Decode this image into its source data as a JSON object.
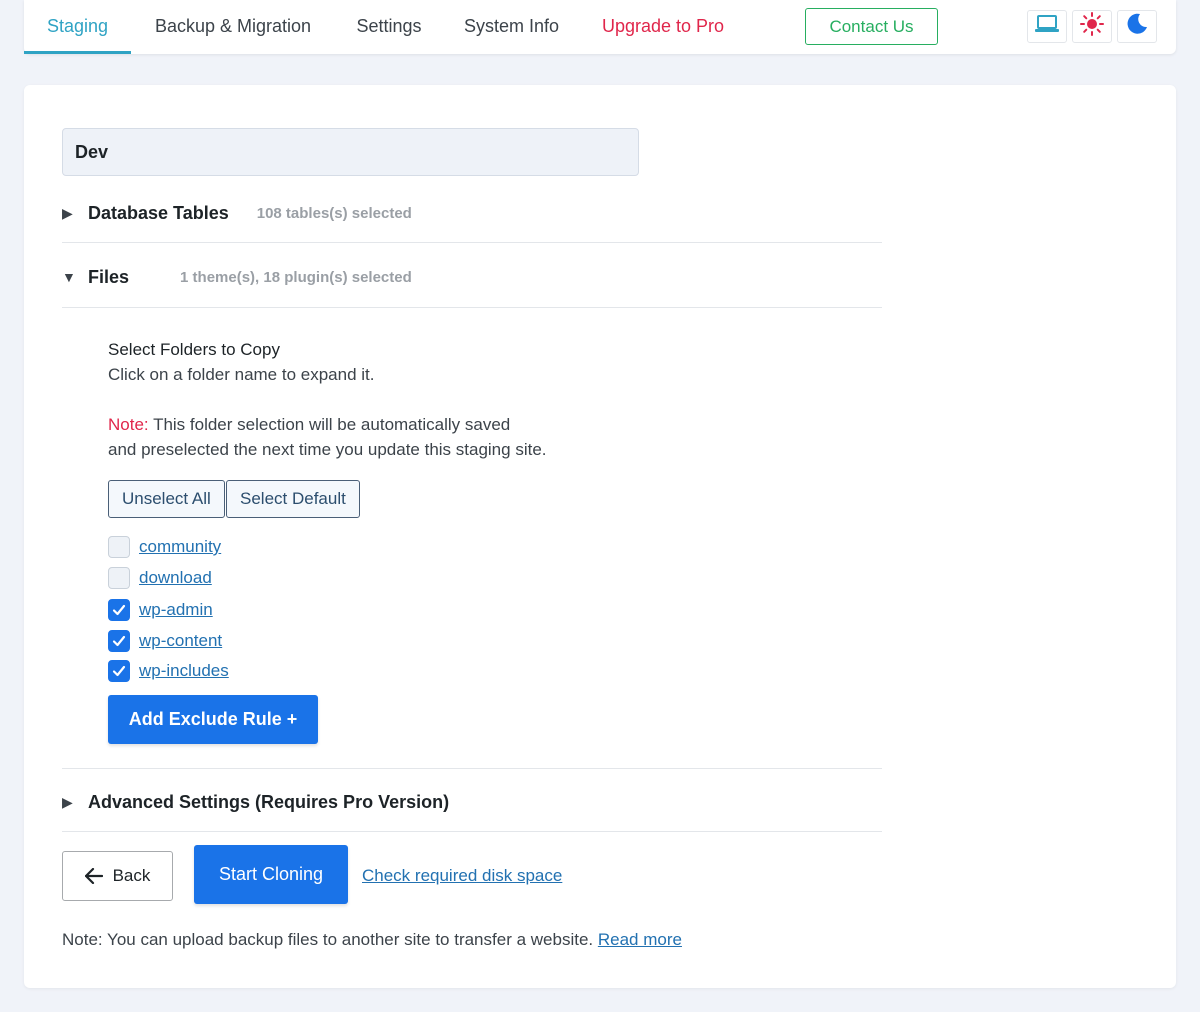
{
  "nav": {
    "tabs": [
      {
        "label": "Staging"
      },
      {
        "label": "Backup & Migration"
      },
      {
        "label": "Settings"
      },
      {
        "label": "System Info"
      },
      {
        "label": "Upgrade to Pro"
      }
    ],
    "active_tab": "Staging",
    "contact_label": "Contact Us",
    "mode_buttons": [
      {
        "icon": "laptop-icon"
      },
      {
        "icon": "sun-icon"
      },
      {
        "icon": "moon-icon"
      }
    ]
  },
  "main": {
    "site_name": "Dev",
    "database": {
      "title": "Database Tables",
      "meta": "108 tables(s) selected",
      "expanded": false
    },
    "files": {
      "title": "Files",
      "meta": "1 theme(s), 18 plugin(s) selected",
      "expanded": true,
      "heading": "Select Folders to Copy",
      "subheading": "Click on a folder name to expand it.",
      "note_label": "Note:",
      "note_line1": "This folder selection will be automatically saved",
      "note_line2": "and preselected the next time you update this staging site.",
      "unselect_all_label": "Unselect All",
      "select_default_label": "Select Default",
      "folders": [
        {
          "name": "community",
          "checked": false
        },
        {
          "name": "download",
          "checked": false
        },
        {
          "name": "wp-admin",
          "checked": true
        },
        {
          "name": "wp-content",
          "checked": true
        },
        {
          "name": "wp-includes",
          "checked": true
        }
      ],
      "exclude_rule_label": "Add Exclude Rule +"
    },
    "advanced": {
      "title": "Advanced Settings (Requires Pro Version)",
      "expanded": false
    },
    "back_label": "Back",
    "start_label": "Start Cloning",
    "disk_space_label": "Check required disk space",
    "footer_note": "Note: You can upload backup files to another site to transfer a website.",
    "read_more_label": "Read more"
  },
  "colors": {
    "accent": "#2fa3c4",
    "primary": "#1a73e8",
    "pro": "#e0264b",
    "contact": "#27ae60",
    "link": "#2271b1"
  }
}
